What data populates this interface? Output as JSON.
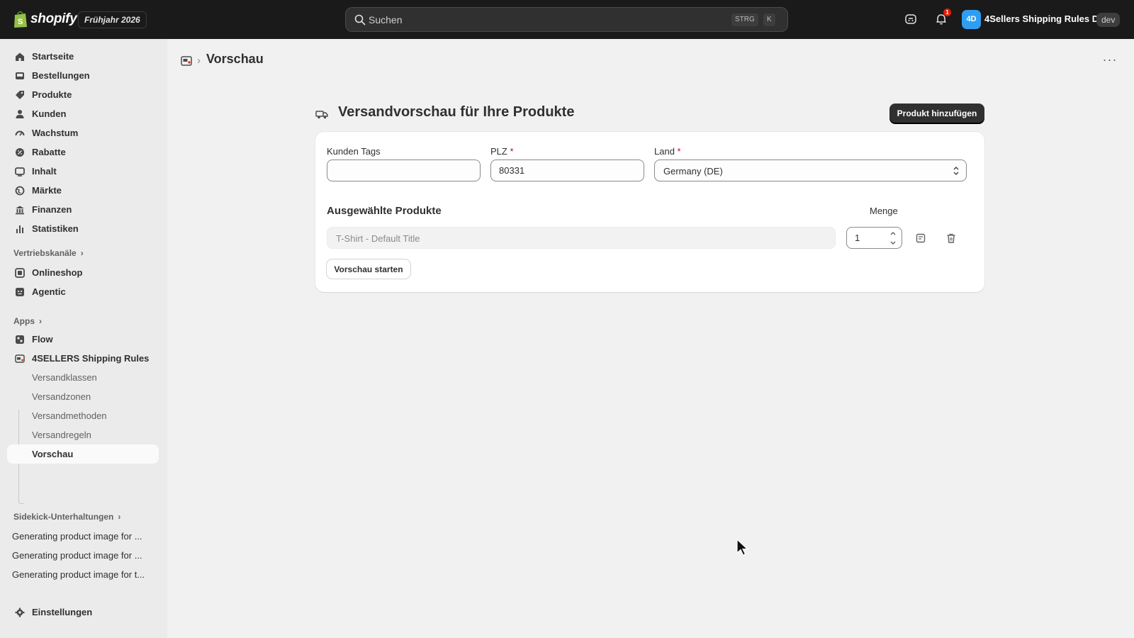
{
  "topbar": {
    "logo_text": "shopify",
    "edition": "Frühjahr 2026",
    "search_placeholder": "Suchen",
    "search_shortcut_1": "STRG",
    "search_shortcut_2": "K",
    "notification_count": "1",
    "store_initials": "4D",
    "store_name": "4Sellers Shipping Rules D...",
    "env_badge": "dev"
  },
  "sidebar": {
    "main_items": [
      {
        "label": "Startseite",
        "icon": "home-icon"
      },
      {
        "label": "Bestellungen",
        "icon": "inbox-icon"
      },
      {
        "label": "Produkte",
        "icon": "tag-icon"
      },
      {
        "label": "Kunden",
        "icon": "person-icon"
      },
      {
        "label": "Wachstum",
        "icon": "gauge-icon"
      },
      {
        "label": "Rabatte",
        "icon": "discount-icon"
      },
      {
        "label": "Inhalt",
        "icon": "content-icon"
      },
      {
        "label": "Märkte",
        "icon": "globe-icon"
      },
      {
        "label": "Finanzen",
        "icon": "bank-icon"
      },
      {
        "label": "Statistiken",
        "icon": "bar-chart-icon"
      }
    ],
    "sales_channels_label": "Vertriebskanäle",
    "channels": [
      {
        "label": "Onlineshop",
        "icon": "store-icon"
      },
      {
        "label": "Agentic",
        "icon": "agentic-icon"
      }
    ],
    "apps_label": "Apps",
    "apps": [
      {
        "label": "Flow",
        "icon": "flow-icon"
      },
      {
        "label": "4SELLERS Shipping Rules",
        "icon": "truck-app-icon"
      }
    ],
    "app_sub_items": [
      {
        "label": "Versandklassen"
      },
      {
        "label": "Versandzonen"
      },
      {
        "label": "Versandmethoden"
      },
      {
        "label": "Versandregeln"
      },
      {
        "label": "Vorschau"
      }
    ],
    "sidekick_label": "Sidekick-Unterhaltungen",
    "conversations": [
      "Generating product image for ...",
      "Generating product image for ...",
      "Generating product image for t..."
    ],
    "settings_label": "Einstellungen"
  },
  "breadcrumb": {
    "title": "Vorschau",
    "separator": "›"
  },
  "page": {
    "title": "Versandvorschau für Ihre Produkte",
    "add_product_button": "Produkt hinzufügen",
    "form": {
      "customer_tags_label": "Kunden Tags",
      "customer_tags_value": "",
      "zip_label": "PLZ",
      "zip_value": "80331",
      "country_label": "Land",
      "country_value": "Germany (DE)",
      "required_mark": "*"
    },
    "selected_products_title": "Ausgewählte Produkte",
    "quantity_label": "Menge",
    "products": [
      {
        "name": "T-Shirt - Default Title",
        "quantity": "1"
      }
    ],
    "start_preview_button": "Vorschau starten"
  },
  "colors": {
    "topbar_bg": "#1a1a1a",
    "sidebar_bg": "#ebebeb",
    "main_bg": "#f1f1f1",
    "primary_button": "#303030",
    "required": "#c70a24",
    "store_avatar": "#2e9ef3"
  }
}
